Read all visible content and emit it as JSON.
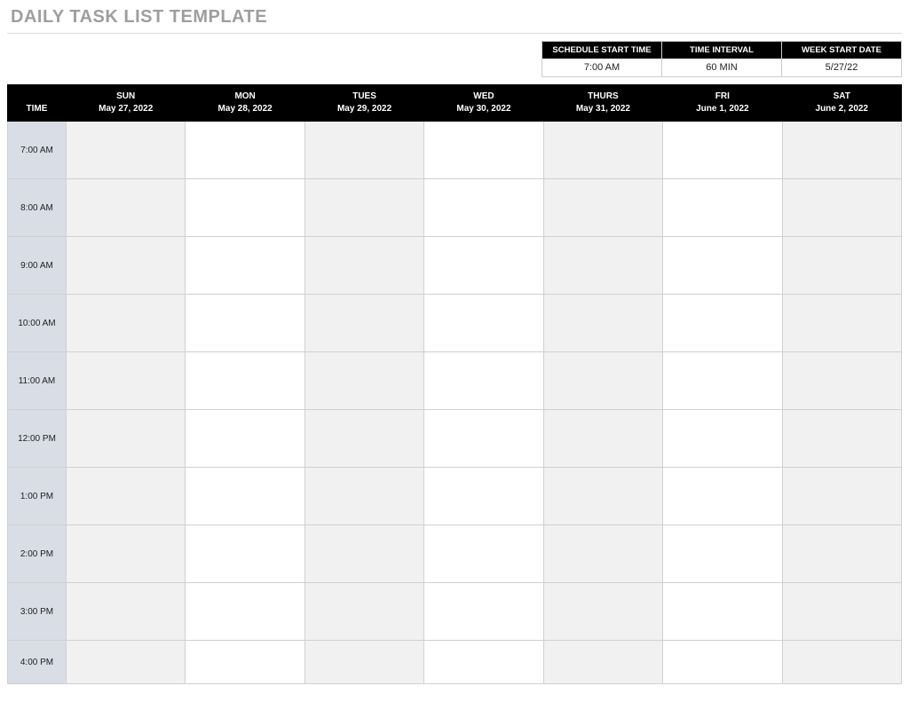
{
  "title": "DAILY TASK LIST TEMPLATE",
  "meta": {
    "schedule_start_time": {
      "label": "SCHEDULE START TIME",
      "value": "7:00 AM"
    },
    "time_interval": {
      "label": "TIME INTERVAL",
      "value": "60 MIN"
    },
    "week_start_date": {
      "label": "WEEK START DATE",
      "value": "5/27/22"
    }
  },
  "columns": {
    "time_label": "TIME",
    "days": [
      {
        "dow": "SUN",
        "date": "May 27, 2022"
      },
      {
        "dow": "MON",
        "date": "May 28, 2022"
      },
      {
        "dow": "TUES",
        "date": "May 29, 2022"
      },
      {
        "dow": "WED",
        "date": "May 30, 2022"
      },
      {
        "dow": "THURS",
        "date": "May 31, 2022"
      },
      {
        "dow": "FRI",
        "date": "June 1, 2022"
      },
      {
        "dow": "SAT",
        "date": "June 2, 2022"
      }
    ]
  },
  "rows": [
    {
      "time": "7:00 AM"
    },
    {
      "time": "8:00 AM"
    },
    {
      "time": "9:00 AM"
    },
    {
      "time": "10:00 AM"
    },
    {
      "time": "11:00 AM"
    },
    {
      "time": "12:00 PM"
    },
    {
      "time": "1:00 PM"
    },
    {
      "time": "2:00 PM"
    },
    {
      "time": "3:00 PM"
    },
    {
      "time": "4:00 PM"
    }
  ]
}
